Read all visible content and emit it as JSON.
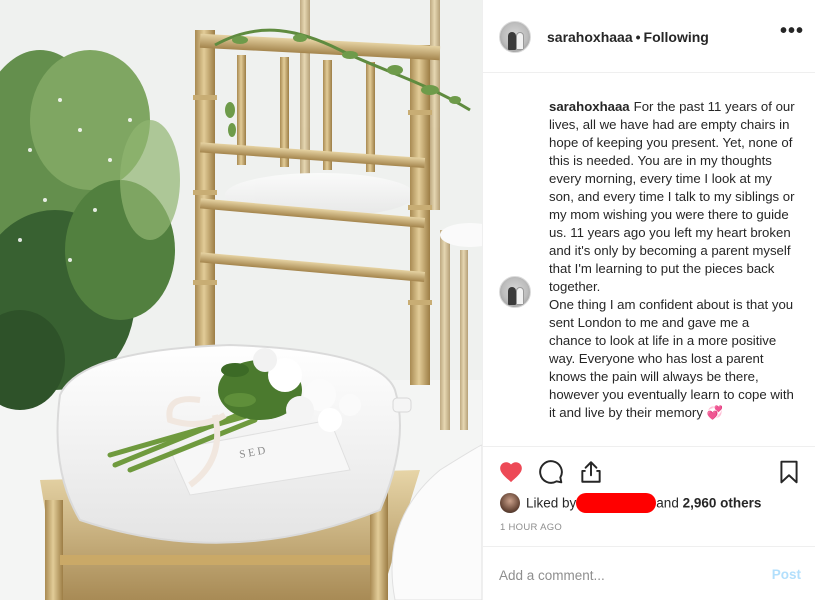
{
  "post": {
    "username": "sarahoxhaaa",
    "follow_status": "Following",
    "more_options": "•••",
    "caption_user": "sarahoxhaaa",
    "caption_paragraphs": [
      "For the past 11 years of our lives, all we have had are empty chairs in hope of keeping you present. Yet, none of this is needed. You are in my thoughts every morning, every time I look at my son, and every time I talk to my siblings or my mom wishing you were there to guide us. 11 years ago you left my heart broken and it's only by becoming a parent myself that I'm learning to put the pieces back together.",
      "One thing I am confident about is that you sent London to me and gave me a chance to look at life in a more positive way. Everyone who has lost a parent knows the pain will always be there, however you eventually learn to cope with it and live by their memory 💞"
    ],
    "likes": {
      "prefix": "Liked by",
      "joiner": "and",
      "others": "2,960 others"
    },
    "timestamp": "1 HOUR AGO",
    "comment_placeholder": "Add a comment...",
    "post_label": "Post"
  },
  "icons": {
    "like": "heart-filled-icon",
    "comment": "comment-bubble-icon",
    "share": "share-upload-icon",
    "save": "bookmark-icon"
  },
  "colors": {
    "like_red": "#ed4956",
    "redaction": "#ff0000",
    "post_disabled": "#b2dffc",
    "meta_gray": "#8e8e8e",
    "divider": "#efefef"
  }
}
